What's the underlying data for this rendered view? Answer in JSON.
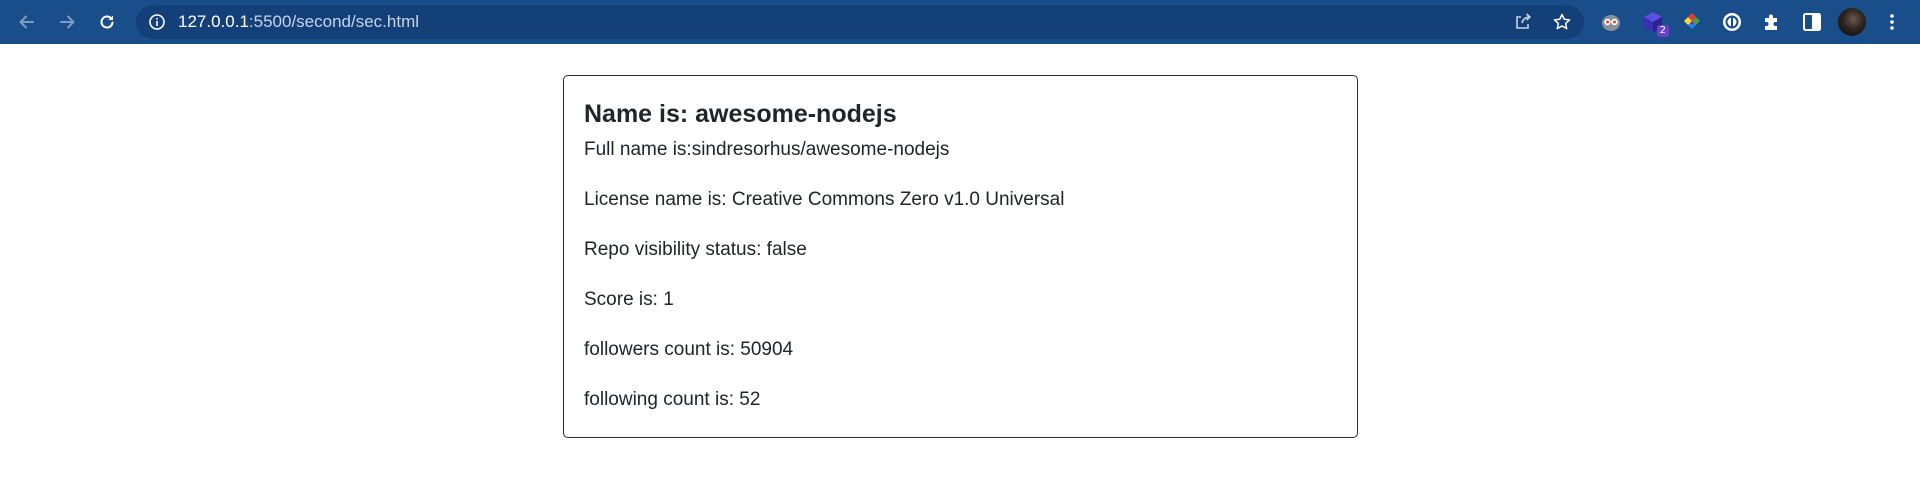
{
  "browser": {
    "url_host": "127.0.0.1",
    "url_rest": ":5500/second/sec.html",
    "icons": {
      "back": "arrow-left-icon",
      "forward": "arrow-right-icon",
      "reload": "reload-icon",
      "site_info": "info-icon",
      "share": "share-icon",
      "bookmark": "star-icon",
      "side_panel": "side-panel-icon",
      "extensions": "puzzle-icon",
      "menu": "kebab-menu-icon"
    },
    "extensions": [
      {
        "name": "owl-extension-icon"
      },
      {
        "name": "cube-extension-icon",
        "badge": "2"
      },
      {
        "name": "color-extension-icon"
      },
      {
        "name": "circle-extension-icon"
      }
    ],
    "colors": {
      "toolbar": "#1a4e8a",
      "omnibox": "#14407a"
    }
  },
  "card": {
    "title": "Name is: awesome-nodejs",
    "full_name": "Full name is:sindresorhus/awesome-nodejs",
    "license": "License name is: Creative Commons Zero v1.0 Universal",
    "visibility": "Repo visibility status: false",
    "score": "Score is: 1",
    "followers": "followers count is: 50904",
    "following": "following count is: 52"
  }
}
